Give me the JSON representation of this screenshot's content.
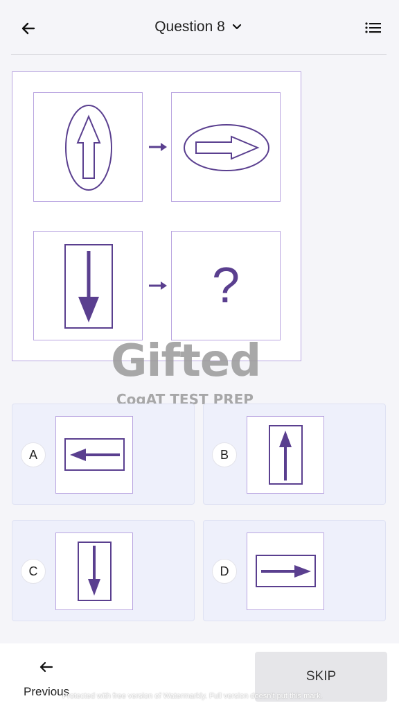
{
  "header": {
    "title": "Question 8",
    "back_icon": "arrow-left-icon",
    "dropdown_icon": "chevron-down-icon",
    "list_icon": "list-icon"
  },
  "puzzle": {
    "unknown_symbol": "?"
  },
  "watermark": {
    "brand": "Gifted",
    "tagline": "CogAT TEST PREP"
  },
  "options": [
    {
      "letter": "A"
    },
    {
      "letter": "B"
    },
    {
      "letter": "C"
    },
    {
      "letter": "D"
    }
  ],
  "footer": {
    "previous_label": "Previous",
    "skip_label": "SKIP",
    "protection_note": "Protected with free version of Watermarkly. Full version doesn't put this mark."
  },
  "colors": {
    "accent": "#5a3f8f",
    "cell_border": "#b8a4e0",
    "option_bg": "#eef0fb",
    "page_bg": "#f5f5f9"
  }
}
